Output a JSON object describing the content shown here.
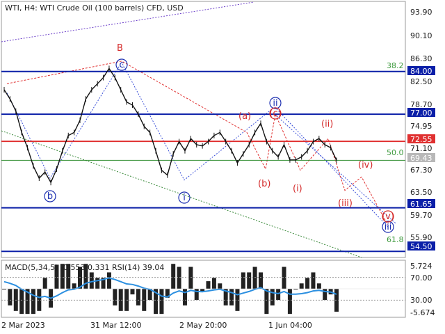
{
  "header": {
    "text": "WTI, H4:  WTI Crude Oil (100 barrels) CFD, USD"
  },
  "price_axis": {
    "ticks": [
      "93.90",
      "90.10",
      "86.30",
      "82.50",
      "78.70",
      "74.95",
      "71.10",
      "67.30",
      "63.50",
      "59.70",
      "55.90"
    ]
  },
  "indicator": {
    "label": "MACD(5,34,5) -0.553 0.331 RSI(14) 39.04",
    "ticks": [
      "5.724",
      "70.00",
      "30.00",
      "-5.674"
    ]
  },
  "time_axis": {
    "labels": [
      "2 Mar 2023",
      "31 Mar 12:00",
      "2 May 20:00",
      "1 Jun 04:00"
    ]
  },
  "price_badges": [
    {
      "value": "84.00",
      "color": "#0b1fa8"
    },
    {
      "value": "77.00",
      "color": "#0b1fa8"
    },
    {
      "value": "72.55",
      "color": "#e03030"
    },
    {
      "value": "69.43",
      "color": "#b8b8b8"
    },
    {
      "value": "61.65",
      "color": "#0b1fa8"
    },
    {
      "value": "54.50",
      "color": "#0b1fa8"
    }
  ],
  "fib_labels": [
    "38.2",
    "50.0",
    "61.8"
  ],
  "wave_labels": {
    "B": "B",
    "c": "c",
    "b": "b",
    "ii": "ii",
    "i": "i",
    "iii": "iii",
    "a_p": "(a)",
    "b_p": "(b)",
    "c_p": "(c)",
    "i_p": "(i)",
    "ii_p": "(ii)",
    "iii_p": "(iii)",
    "iv_p": "(iv)",
    "v_p": "(v)"
  },
  "chart_data": {
    "type": "line",
    "title": "WTI, H4: WTI Crude Oil (100 barrels) CFD, USD",
    "x": [
      "2 Mar 2023",
      "31 Mar 12:00",
      "2 May 20:00",
      "1 Jun 04:00"
    ],
    "series": [
      {
        "values": [
          81.0,
          79.5,
          77.5,
          74.0,
          71.5,
          68.5,
          66.5,
          67.5,
          65.8,
          68.0,
          71.0,
          73.5,
          74.0,
          76.0,
          79.5,
          81.0,
          82.0,
          83.0,
          84.5,
          83.0,
          81.0,
          79.0,
          78.5,
          77.0,
          75.0,
          74.0,
          71.0,
          67.8,
          67.0,
          70.5,
          72.5,
          71.0,
          73.0,
          72.0,
          71.8,
          72.5,
          73.5,
          74.0,
          72.5,
          71.0,
          69.0,
          70.5,
          72.0,
          74.0,
          75.5,
          72.5,
          71.0,
          70.0,
          72.0,
          69.5,
          69.5,
          70.0,
          71.0,
          72.5,
          73.0,
          72.0,
          71.5,
          69.43
        ]
      }
    ],
    "horizontal_levels": [
      84.0,
      77.0,
      72.55,
      69.43,
      61.65,
      54.5
    ],
    "fibonacci": [
      {
        "label": "38.2",
        "price": 84.0
      },
      {
        "label": "50.0",
        "price": 69.43
      },
      {
        "label": "61.8",
        "price": 54.5
      }
    ],
    "ylim": [
      53.5,
      95.5
    ],
    "indicator": {
      "name": "MACD(5,34,5) -0.553 0.331 RSI(14) 39.04",
      "levels": [
        70,
        30
      ],
      "ylim": [
        -5.674,
        5.724
      ]
    }
  }
}
